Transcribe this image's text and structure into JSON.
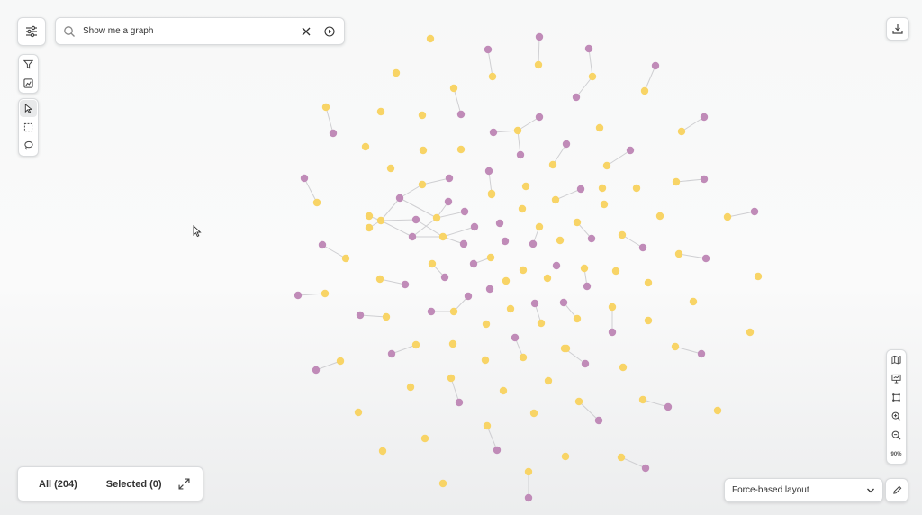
{
  "search": {
    "query": "Show me a graph"
  },
  "footer": {
    "all_label": "All (204)",
    "selected_label": "Selected (0)"
  },
  "layout": {
    "selected": "Force-based layout"
  },
  "zoom": {
    "level_label": "90%"
  },
  "icons": {
    "settings": "sliders-icon",
    "search": "search-icon",
    "clear": "close-icon",
    "run": "play-icon",
    "download": "download-icon",
    "filter": "filter-icon",
    "chart": "chart-icon",
    "select": "pointer-icon",
    "box_select": "box-select-icon",
    "lasso": "lasso-icon",
    "map": "map-icon",
    "presentation": "presentation-icon",
    "fit": "fit-to-screen-icon",
    "zoom_in": "zoom-in-icon",
    "zoom_out": "zoom-out-icon",
    "expand": "expand-icon",
    "edit": "pencil-icon",
    "dropdown": "chevron-down-icon"
  },
  "colors": {
    "node_yellow": "#f8d466",
    "node_purple": "#c08bb8",
    "edge": "#cfcfd2"
  }
}
